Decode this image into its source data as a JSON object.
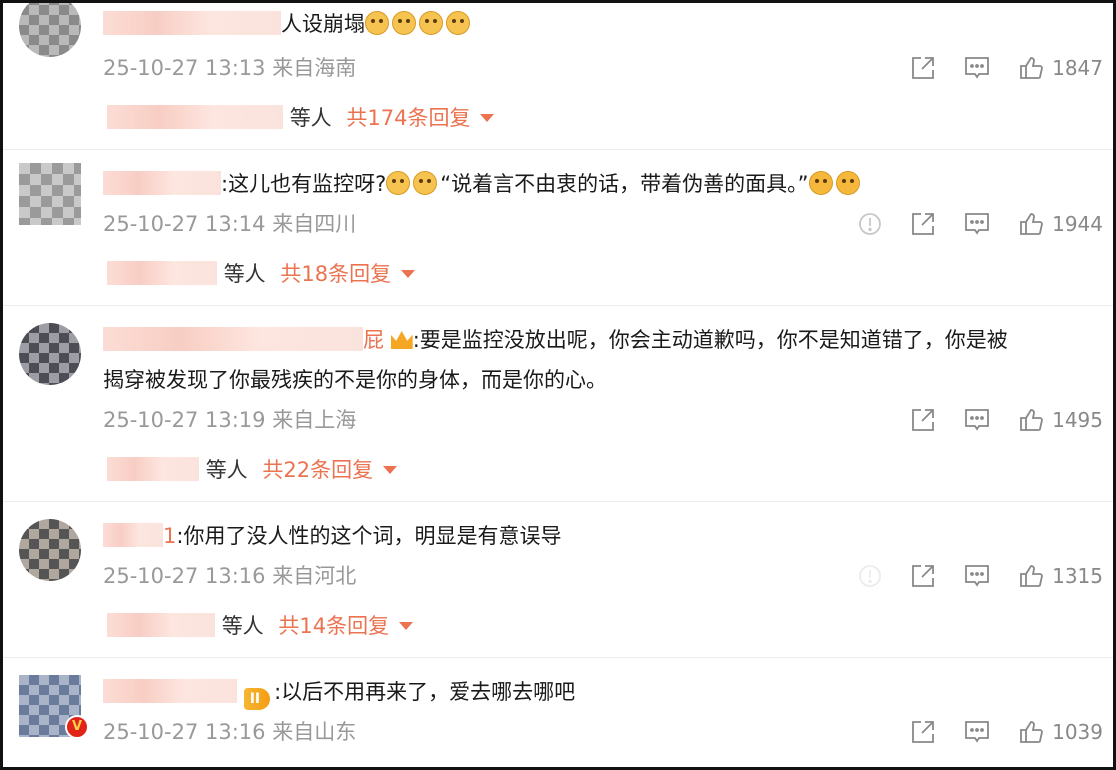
{
  "comments": [
    {
      "text_suffix": "人设崩塌",
      "meta": "25-10-27 13:13 来自海南",
      "likes": "1847",
      "replies": {
        "suffix": "等人",
        "count_label": "共174条回复"
      }
    },
    {
      "text": ":这儿也有监控呀?",
      "text_after_emoji": "“说着言不由衷的话，带着伪善的面具。”",
      "meta": "25-10-27 13:14 来自四川",
      "likes": "1944",
      "replies": {
        "suffix": "等人",
        "count_label": "共18条回复"
      }
    },
    {
      "name_suffix": "屁",
      "text": ":要是监控没放出呢，你会主动道歉吗，你不是知道错了，你是被",
      "text_line2": "揭穿被发现了你最残疾的不是你的身体，而是你的心。",
      "meta": "25-10-27 13:19 来自上海",
      "likes": "1495",
      "replies": {
        "suffix": "等人",
        "count_label": "共22条回复"
      }
    },
    {
      "name_suffix": "1",
      "text": ":你用了没人性的这个词，明显是有意误导",
      "meta": "25-10-27 13:16 来自河北",
      "likes": "1315",
      "replies": {
        "suffix": "等人",
        "count_label": "共14条回复"
      }
    },
    {
      "badge": "II",
      "text": ":以后不用再来了，爱去哪去哪吧",
      "meta": "25-10-27 13:16 来自山东",
      "likes": "1039"
    }
  ],
  "icons": {
    "share": "share-icon",
    "comment": "comment-icon",
    "like": "thumbs-up-icon",
    "report": "report-icon",
    "expand": "caret-down-icon"
  },
  "colors": {
    "accent": "#eb7350",
    "meta": "#999999",
    "text": "#1a1a1a"
  }
}
